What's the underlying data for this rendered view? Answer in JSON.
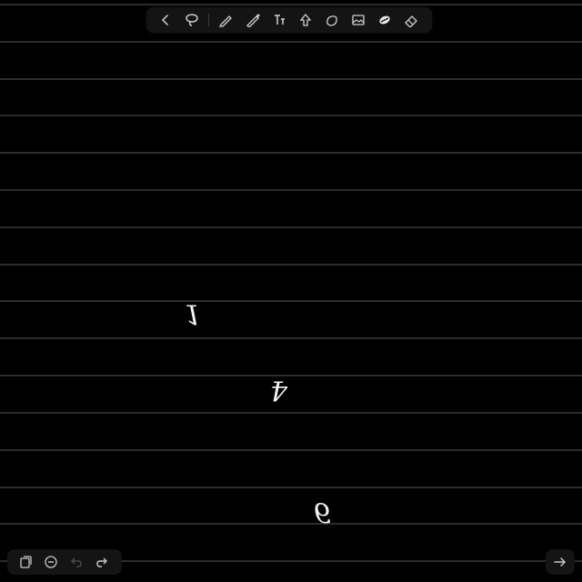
{
  "toolbar": {
    "tools": [
      {
        "icon": "back-chevron-icon"
      },
      {
        "icon": "lasso-icon"
      },
      {
        "icon": "pen-icon"
      },
      {
        "icon": "highlighter-icon"
      },
      {
        "icon": "text-icon"
      },
      {
        "icon": "shape-icon"
      },
      {
        "icon": "sticky-note-icon"
      },
      {
        "icon": "image-icon"
      },
      {
        "icon": "fill-pen-icon",
        "active": true
      },
      {
        "icon": "eraser-icon"
      }
    ]
  },
  "canvas": {
    "background": "#000000",
    "line_color": "#3a3a3a",
    "ink_color": "#f2f2f2",
    "handwriting": [
      {
        "text": "1"
      },
      {
        "text": "4"
      },
      {
        "text": "6"
      }
    ]
  },
  "bottom_left": {
    "buttons": [
      {
        "icon": "pages-icon"
      },
      {
        "icon": "zoom-out-icon"
      },
      {
        "icon": "undo-icon"
      },
      {
        "icon": "redo-icon"
      }
    ]
  },
  "bottom_right": {
    "icon": "next-arrow-icon"
  }
}
